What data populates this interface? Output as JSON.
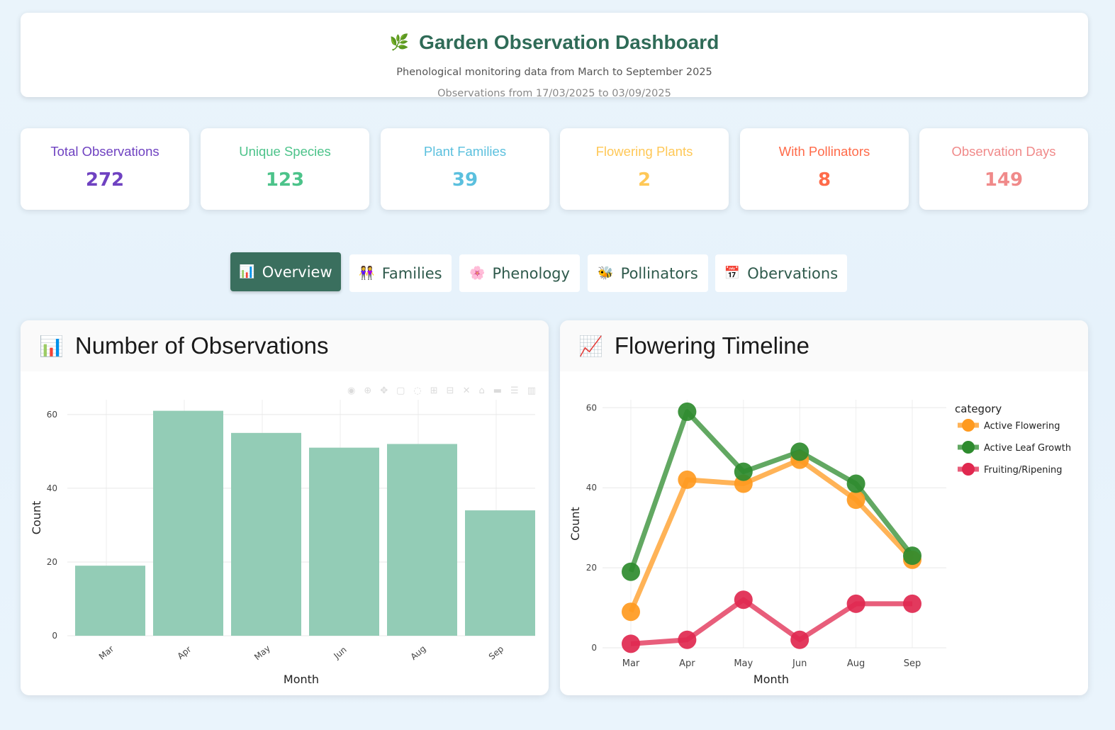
{
  "header": {
    "icon": "leaf-icon",
    "title": "Garden Observation Dashboard",
    "subtitle": "Phenological monitoring data from March to September 2025",
    "range": "Observations from 17/03/2025 to 03/09/2025"
  },
  "stats": [
    {
      "label": "Total Observations",
      "value": "272",
      "color": "#6f42c1"
    },
    {
      "label": "Unique Species",
      "value": "123",
      "color": "#4cc38a"
    },
    {
      "label": "Plant Families",
      "value": "39",
      "color": "#5bc0de"
    },
    {
      "label": "Flowering Plants",
      "value": "2",
      "color": "#ffc857"
    },
    {
      "label": "With Pollinators",
      "value": "8",
      "color": "#ff6b4a"
    },
    {
      "label": "Observation Days",
      "value": "149",
      "color": "#f08a8a"
    }
  ],
  "tabs": [
    {
      "label": "Overview",
      "icon": "bar-chart-icon",
      "glyph": "📊",
      "active": true
    },
    {
      "label": "Families",
      "icon": "people-icon",
      "glyph": "👭",
      "active": false
    },
    {
      "label": "Phenology",
      "icon": "flower-icon",
      "glyph": "🌸",
      "active": false
    },
    {
      "label": "Pollinators",
      "icon": "bee-icon",
      "glyph": "🐝",
      "active": false
    },
    {
      "label": "Obervations",
      "icon": "calendar-icon",
      "glyph": "📅",
      "active": false
    }
  ],
  "panels": {
    "left": {
      "title": "Number of Observations",
      "icon": "bar-chart-icon",
      "glyph": "📊"
    },
    "right": {
      "title": "Flowering Timeline",
      "icon": "trend-chart-icon",
      "glyph": "📈"
    }
  },
  "chart_data": [
    {
      "type": "bar",
      "categories": [
        "Mar",
        "Apr",
        "May",
        "Jun",
        "Aug",
        "Sep"
      ],
      "values": [
        19,
        61,
        55,
        51,
        52,
        34
      ],
      "xlabel": "Month",
      "ylabel": "Count",
      "ylim": [
        0,
        64
      ],
      "yticks": [
        0,
        20,
        40,
        60
      ],
      "color": "#93ccb6",
      "grid": true
    },
    {
      "type": "line",
      "x": [
        "Mar",
        "Apr",
        "May",
        "Jun",
        "Aug",
        "Sep"
      ],
      "series": [
        {
          "name": "Active Flowering",
          "values": [
            9,
            42,
            41,
            47,
            37,
            22
          ],
          "color": "#ff9a1f"
        },
        {
          "name": "Active Leaf Growth",
          "values": [
            19,
            59,
            44,
            49,
            41,
            23
          ],
          "color": "#2e8b2e"
        },
        {
          "name": "Fruiting/Ripening",
          "values": [
            1,
            2,
            12,
            2,
            11,
            11
          ],
          "color": "#e0284f"
        }
      ],
      "legend_title": "category",
      "legend_position": "top-right",
      "xlabel": "Month",
      "ylabel": "Count",
      "ylim": [
        0,
        62
      ],
      "yticks": [
        0,
        20,
        40,
        60
      ],
      "grid": true
    }
  ]
}
